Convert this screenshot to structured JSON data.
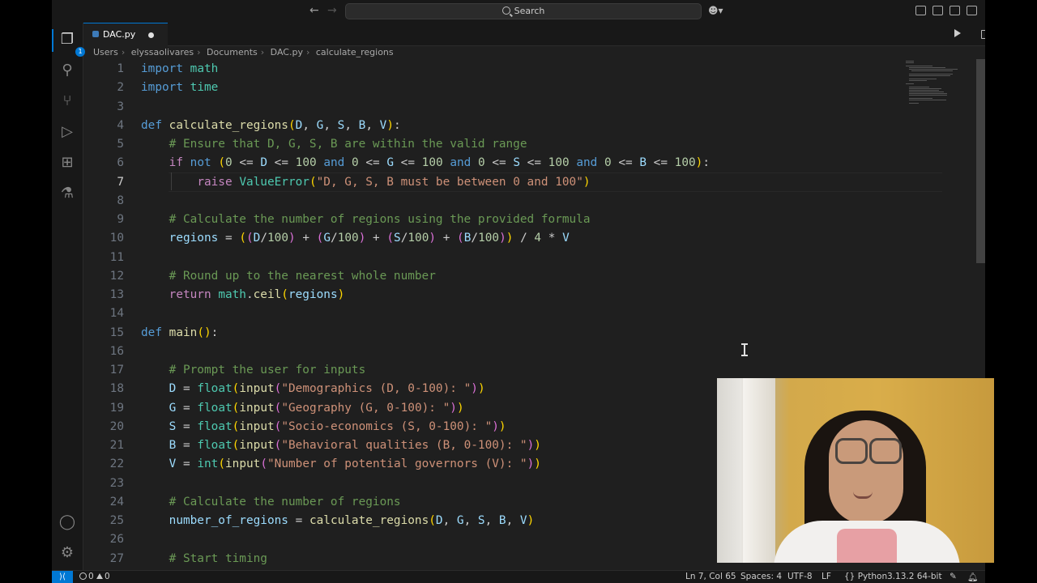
{
  "titlebar": {
    "search_placeholder": "Search"
  },
  "tab": {
    "filename": "DAC.py",
    "modified": true
  },
  "breadcrumb": [
    "Users",
    "elyssaolivares",
    "Documents",
    "DAC.py",
    "calculate_regions"
  ],
  "editor": {
    "current_line": 7,
    "lines": [
      {
        "n": "1",
        "html": "<span class='kw'>import</span> <span class='cls'>math</span>"
      },
      {
        "n": "2",
        "html": "<span class='kw'>import</span> <span class='cls'>time</span>"
      },
      {
        "n": "3",
        "html": ""
      },
      {
        "n": "4",
        "html": "<span class='kw'>def</span> <span class='fn'>calculate_regions</span><span class='br1'>(</span><span class='var'>D</span>, <span class='var'>G</span>, <span class='var'>S</span>, <span class='var'>B</span>, <span class='var'>V</span><span class='br1'>)</span>:"
      },
      {
        "n": "5",
        "html": "    <span class='cmt'># Ensure that D, G, S, B are within the valid range</span>"
      },
      {
        "n": "6",
        "html": "    <span class='ctl'>if</span> <span class='kw'>not</span> <span class='br1'>(</span><span class='num'>0</span> &lt;= <span class='var'>D</span> &lt;= <span class='num'>100</span> <span class='kw'>and</span> <span class='num'>0</span> &lt;= <span class='var'>G</span> &lt;= <span class='num'>100</span> <span class='kw'>and</span> <span class='num'>0</span> &lt;= <span class='var'>S</span> &lt;= <span class='num'>100</span> <span class='kw'>and</span> <span class='num'>0</span> &lt;= <span class='var'>B</span> &lt;= <span class='num'>100</span><span class='br1'>)</span>:"
      },
      {
        "n": "7",
        "html": "        <span class='ctl'>raise</span> <span class='cls'>ValueError</span><span class='br1'>(</span><span class='str'>\"D, G, S, B must be between 0 and 100\"</span><span class='br1'>)</span>"
      },
      {
        "n": "8",
        "html": ""
      },
      {
        "n": "9",
        "html": "    <span class='cmt'># Calculate the number of regions using the provided formula</span>"
      },
      {
        "n": "10",
        "html": "    <span class='var'>regions</span> = <span class='br1'>(</span><span class='br2'>(</span><span class='var'>D</span>/<span class='num'>100</span><span class='br2'>)</span> + <span class='br2'>(</span><span class='var'>G</span>/<span class='num'>100</span><span class='br2'>)</span> + <span class='br2'>(</span><span class='var'>S</span>/<span class='num'>100</span><span class='br2'>)</span> + <span class='br2'>(</span><span class='var'>B</span>/<span class='num'>100</span><span class='br2'>)</span><span class='br1'>)</span> / <span class='num'>4</span> * <span class='var'>V</span>"
      },
      {
        "n": "11",
        "html": ""
      },
      {
        "n": "12",
        "html": "    <span class='cmt'># Round up to the nearest whole number</span>"
      },
      {
        "n": "13",
        "html": "    <span class='ctl'>return</span> <span class='cls'>math</span>.<span class='fn'>ceil</span><span class='br1'>(</span><span class='var'>regions</span><span class='br1'>)</span>"
      },
      {
        "n": "14",
        "html": ""
      },
      {
        "n": "15",
        "html": "<span class='kw'>def</span> <span class='fn'>main</span><span class='br1'>()</span>:"
      },
      {
        "n": "16",
        "html": ""
      },
      {
        "n": "17",
        "html": "    <span class='cmt'># Prompt the user for inputs</span>"
      },
      {
        "n": "18",
        "html": "    <span class='var'>D</span> = <span class='cls'>float</span><span class='br1'>(</span><span class='fn'>input</span><span class='br2'>(</span><span class='str'>\"Demographics (D, 0-100): \"</span><span class='br2'>)</span><span class='br1'>)</span>"
      },
      {
        "n": "19",
        "html": "    <span class='var'>G</span> = <span class='cls'>float</span><span class='br1'>(</span><span class='fn'>input</span><span class='br2'>(</span><span class='str'>\"Geography (G, 0-100): \"</span><span class='br2'>)</span><span class='br1'>)</span>"
      },
      {
        "n": "20",
        "html": "    <span class='var'>S</span> = <span class='cls'>float</span><span class='br1'>(</span><span class='fn'>input</span><span class='br2'>(</span><span class='str'>\"Socio-economics (S, 0-100): \"</span><span class='br2'>)</span><span class='br1'>)</span>"
      },
      {
        "n": "21",
        "html": "    <span class='var'>B</span> = <span class='cls'>float</span><span class='br1'>(</span><span class='fn'>input</span><span class='br2'>(</span><span class='str'>\"Behavioral qualities (B, 0-100): \"</span><span class='br2'>)</span><span class='br1'>)</span>"
      },
      {
        "n": "22",
        "html": "    <span class='var'>V</span> = <span class='cls'>int</span><span class='br1'>(</span><span class='fn'>input</span><span class='br2'>(</span><span class='str'>\"Number of potential governors (V): \"</span><span class='br2'>)</span><span class='br1'>)</span>"
      },
      {
        "n": "23",
        "html": ""
      },
      {
        "n": "24",
        "html": "    <span class='cmt'># Calculate the number of regions</span>"
      },
      {
        "n": "25",
        "html": "    <span class='var'>number_of_regions</span> = <span class='fn'>calculate_regions</span><span class='br1'>(</span><span class='var'>D</span>, <span class='var'>G</span>, <span class='var'>S</span>, <span class='var'>B</span>, <span class='var'>V</span><span class='br1'>)</span>"
      },
      {
        "n": "26",
        "html": ""
      },
      {
        "n": "27",
        "html": "    <span class='cmt'># Start timing</span>"
      }
    ]
  },
  "statusbar": {
    "problems": "0",
    "warnings": "0",
    "cursor_pos": "Ln 7, Col 65",
    "indent": "Spaces: 4",
    "encoding": "UTF-8",
    "eol": "LF",
    "language": "Python",
    "interpreter": "3.13.2 64-bit"
  },
  "colors": {
    "accent": "#0078d4",
    "background": "#1f1f1f"
  }
}
